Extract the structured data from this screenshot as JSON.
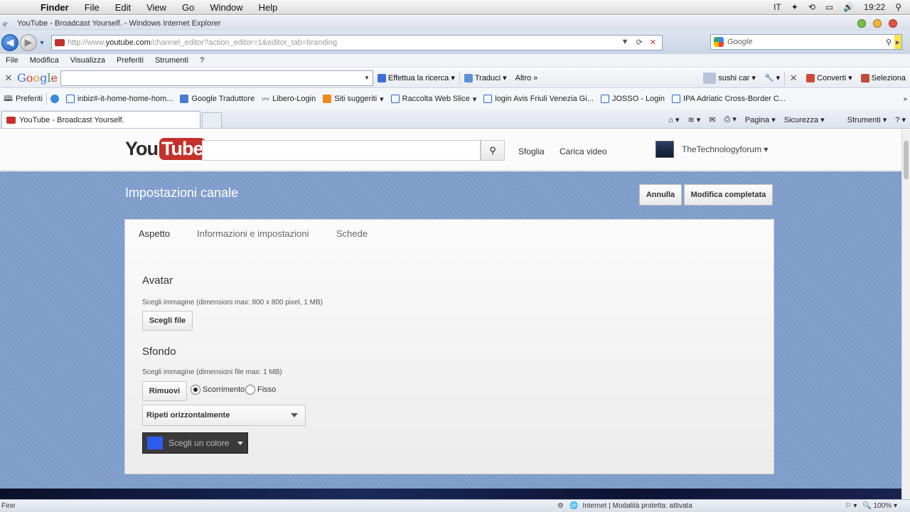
{
  "mac_menu": {
    "app": "Finder",
    "items": [
      "File",
      "Edit",
      "View",
      "Go",
      "Window",
      "Help"
    ],
    "input_lang": "IT",
    "clock": "19:22"
  },
  "window": {
    "title": "YouTube - Broadcast Yourself. - Windows Internet Explorer"
  },
  "address": {
    "url_prefix": "http://www.",
    "url_domain": "youtube.com",
    "url_path": "/channel_editor?action_editor=1&editor_tab=branding",
    "search_placeholder": "Google"
  },
  "ie_menu": [
    "File",
    "Modifica",
    "Visualizza",
    "Preferiti",
    "Strumenti",
    "?"
  ],
  "google_toolbar": {
    "search_label": "Effettua la ricerca",
    "translate": "Traduci",
    "more": "Altro",
    "user": "sushi car",
    "convert": "Converti",
    "select": "Seleziona"
  },
  "favorites": [
    "Preferiti",
    "inbiz#-it-home-home-hom...",
    "Google Traduttore",
    "Libero-Login",
    "Siti suggeriti",
    "Raccolta Web Slice",
    "login Avis Friuli Venezia Gi...",
    "JOSSO - Login",
    "IPA Adriatic Cross-Border C..."
  ],
  "tabs": {
    "active": "YouTube - Broadcast Yourself.",
    "tools": [
      "Pagina",
      "Sicurezza",
      "Strumenti"
    ]
  },
  "yt_header": {
    "logo_you": "You",
    "logo_tube": "Tube",
    "browse": "Sfoglia",
    "upload": "Carica video",
    "username": "TheTechnologyforum"
  },
  "channel": {
    "title": "Impostazioni canale",
    "cancel": "Annulla",
    "done": "Modifica completata",
    "tabs": [
      "Aspetto",
      "Informazioni e impostazioni",
      "Schede"
    ],
    "avatar": {
      "heading": "Avatar",
      "hint": "Scegli immagine (dimensioni max: 800 x 800 pixel, 1 MB)",
      "button": "Scegli file"
    },
    "background": {
      "heading": "Sfondo",
      "hint": "Scegli immagine (dimensioni file max: 1 MB)",
      "remove": "Rimuovi",
      "scroll": "Scorrimento",
      "fixed": "Fisso",
      "repeat": "Ripeti orizzontalmente",
      "color_button": "Scegli un colore",
      "color_value": "#2f5cf0"
    }
  },
  "status": {
    "left": "Fine",
    "zone": "Internet | Modalità protetta: attivata",
    "zoom": "100%"
  }
}
